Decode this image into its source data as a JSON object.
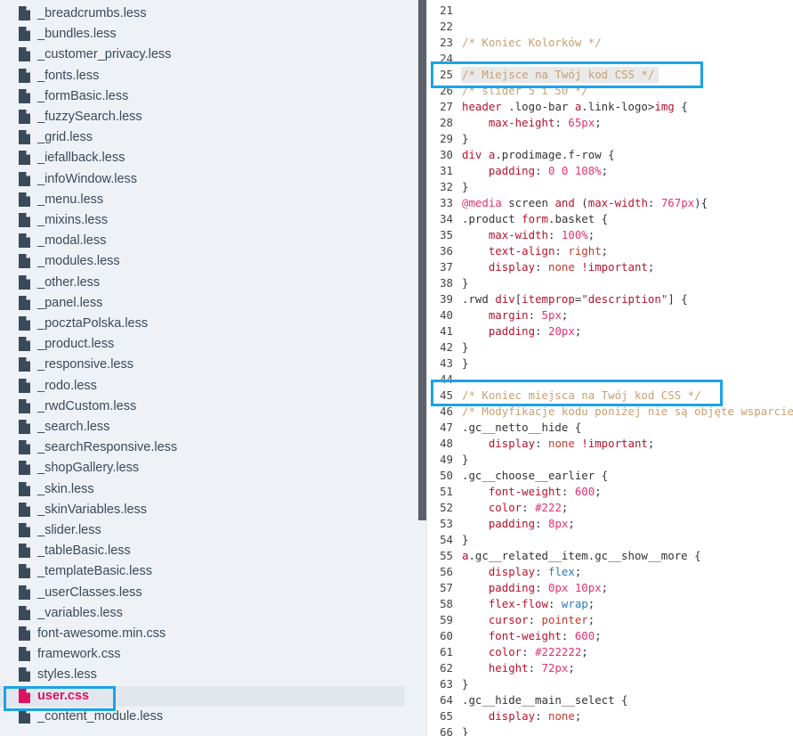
{
  "sidebar": {
    "files": [
      {
        "name": "_breadcrumbs.less"
      },
      {
        "name": "_bundles.less"
      },
      {
        "name": "_customer_privacy.less"
      },
      {
        "name": "_fonts.less"
      },
      {
        "name": "_formBasic.less"
      },
      {
        "name": "_fuzzySearch.less"
      },
      {
        "name": "_grid.less"
      },
      {
        "name": "_iefallback.less"
      },
      {
        "name": "_infoWindow.less"
      },
      {
        "name": "_menu.less"
      },
      {
        "name": "_mixins.less"
      },
      {
        "name": "_modal.less"
      },
      {
        "name": "_modules.less"
      },
      {
        "name": "_other.less"
      },
      {
        "name": "_panel.less"
      },
      {
        "name": "_pocztaPolska.less"
      },
      {
        "name": "_product.less"
      },
      {
        "name": "_responsive.less"
      },
      {
        "name": "_rodo.less"
      },
      {
        "name": "_rwdCustom.less"
      },
      {
        "name": "_search.less"
      },
      {
        "name": "_searchResponsive.less"
      },
      {
        "name": "_shopGallery.less"
      },
      {
        "name": "_skin.less"
      },
      {
        "name": "_skinVariables.less"
      },
      {
        "name": "_slider.less"
      },
      {
        "name": "_tableBasic.less"
      },
      {
        "name": "_templateBasic.less"
      },
      {
        "name": "_userClasses.less"
      },
      {
        "name": "_variables.less"
      },
      {
        "name": "font-awesome.min.css"
      },
      {
        "name": "framework.css"
      },
      {
        "name": "styles.less"
      },
      {
        "name": "user.css",
        "active": true
      },
      {
        "name": "_content_module.less"
      }
    ]
  },
  "editor": {
    "lines": [
      {
        "n": "21",
        "code": []
      },
      {
        "n": "22",
        "code": []
      },
      {
        "n": "23",
        "code": [
          {
            "t": "/* Koniec Kolorków */",
            "c": "com"
          }
        ]
      },
      {
        "n": "24",
        "code": []
      },
      {
        "n": "25",
        "code": [
          {
            "t": "/* Miejsce na Twój kod CSS */",
            "c": "com"
          }
        ],
        "selected": true
      },
      {
        "n": "26",
        "code": [
          {
            "t": "/* slider 5 i 50 */",
            "c": "com"
          }
        ]
      },
      {
        "n": "27",
        "code": [
          {
            "t": "header",
            "c": "kw"
          },
          {
            "t": " .logo-bar ",
            "c": ""
          },
          {
            "t": "a",
            "c": "kw"
          },
          {
            "t": ".link-logo>",
            "c": ""
          },
          {
            "t": "img",
            "c": "kw"
          },
          {
            "t": " {",
            "c": ""
          }
        ]
      },
      {
        "n": "28",
        "code": [
          {
            "t": "    max-height",
            "c": "kw"
          },
          {
            "t": ": ",
            "c": ""
          },
          {
            "t": "65px",
            "c": "num"
          },
          {
            "t": ";",
            "c": ""
          }
        ]
      },
      {
        "n": "29",
        "code": [
          {
            "t": "}",
            "c": ""
          }
        ]
      },
      {
        "n": "30",
        "code": [
          {
            "t": "div",
            "c": "kw"
          },
          {
            "t": " ",
            "c": ""
          },
          {
            "t": "a",
            "c": "kw"
          },
          {
            "t": ".prodimage.f-row {",
            "c": ""
          }
        ]
      },
      {
        "n": "31",
        "code": [
          {
            "t": "    padding",
            "c": "kw"
          },
          {
            "t": ": ",
            "c": ""
          },
          {
            "t": "0 0 108%",
            "c": "num"
          },
          {
            "t": ";",
            "c": ""
          }
        ]
      },
      {
        "n": "32",
        "code": [
          {
            "t": "}",
            "c": ""
          }
        ]
      },
      {
        "n": "33",
        "code": [
          {
            "t": "@media",
            "c": "at"
          },
          {
            "t": " screen ",
            "c": ""
          },
          {
            "t": "and",
            "c": "kw"
          },
          {
            "t": " (",
            "c": ""
          },
          {
            "t": "max-width",
            "c": "kw"
          },
          {
            "t": ": ",
            "c": ""
          },
          {
            "t": "767px",
            "c": "num"
          },
          {
            "t": "){",
            "c": ""
          }
        ]
      },
      {
        "n": "34",
        "code": [
          {
            "t": ".product ",
            "c": ""
          },
          {
            "t": "form",
            "c": "kw"
          },
          {
            "t": ".basket {",
            "c": ""
          }
        ]
      },
      {
        "n": "35",
        "code": [
          {
            "t": "    max-width",
            "c": "kw"
          },
          {
            "t": ": ",
            "c": ""
          },
          {
            "t": "100%",
            "c": "num"
          },
          {
            "t": ";",
            "c": ""
          }
        ]
      },
      {
        "n": "36",
        "code": [
          {
            "t": "    text-align",
            "c": "kw"
          },
          {
            "t": ": ",
            "c": ""
          },
          {
            "t": "right",
            "c": "val"
          },
          {
            "t": ";",
            "c": ""
          }
        ]
      },
      {
        "n": "37",
        "code": [
          {
            "t": "    display",
            "c": "kw"
          },
          {
            "t": ": ",
            "c": ""
          },
          {
            "t": "none",
            "c": "val"
          },
          {
            "t": " ",
            "c": ""
          },
          {
            "t": "!important",
            "c": "kw"
          },
          {
            "t": ";",
            "c": ""
          }
        ]
      },
      {
        "n": "38",
        "code": [
          {
            "t": "}",
            "c": ""
          }
        ]
      },
      {
        "n": "39",
        "code": [
          {
            "t": ".rwd ",
            "c": ""
          },
          {
            "t": "div",
            "c": "kw"
          },
          {
            "t": "[",
            "c": ""
          },
          {
            "t": "itemprop",
            "c": "kw"
          },
          {
            "t": "=",
            "c": ""
          },
          {
            "t": "\"description\"",
            "c": "str"
          },
          {
            "t": "] {",
            "c": ""
          }
        ]
      },
      {
        "n": "40",
        "code": [
          {
            "t": "    margin",
            "c": "kw"
          },
          {
            "t": ": ",
            "c": ""
          },
          {
            "t": "5px",
            "c": "num"
          },
          {
            "t": ";",
            "c": ""
          }
        ]
      },
      {
        "n": "41",
        "code": [
          {
            "t": "    padding",
            "c": "kw"
          },
          {
            "t": ": ",
            "c": ""
          },
          {
            "t": "20px",
            "c": "num"
          },
          {
            "t": ";",
            "c": ""
          }
        ]
      },
      {
        "n": "42",
        "code": [
          {
            "t": "}",
            "c": ""
          }
        ]
      },
      {
        "n": "43",
        "code": [
          {
            "t": "}",
            "c": ""
          }
        ]
      },
      {
        "n": "44",
        "code": []
      },
      {
        "n": "45",
        "code": [
          {
            "t": "/* Koniec miejsca na Twój kod CSS */",
            "c": "com"
          }
        ]
      },
      {
        "n": "46",
        "code": [
          {
            "t": "/* Modyfikacje kodu poniżej nie są objęte wsparciem",
            "c": "com"
          }
        ]
      },
      {
        "n": "47",
        "code": [
          {
            "t": ".gc__netto__hide {",
            "c": ""
          }
        ]
      },
      {
        "n": "48",
        "code": [
          {
            "t": "    display",
            "c": "kw"
          },
          {
            "t": ": ",
            "c": ""
          },
          {
            "t": "none",
            "c": "val"
          },
          {
            "t": " ",
            "c": ""
          },
          {
            "t": "!important",
            "c": "kw"
          },
          {
            "t": ";",
            "c": ""
          }
        ]
      },
      {
        "n": "49",
        "code": [
          {
            "t": "}",
            "c": ""
          }
        ]
      },
      {
        "n": "50",
        "code": [
          {
            "t": ".gc__choose__earlier {",
            "c": ""
          }
        ]
      },
      {
        "n": "51",
        "code": [
          {
            "t": "    font-weight",
            "c": "kw"
          },
          {
            "t": ": ",
            "c": ""
          },
          {
            "t": "600",
            "c": "num"
          },
          {
            "t": ";",
            "c": ""
          }
        ]
      },
      {
        "n": "52",
        "code": [
          {
            "t": "    color",
            "c": "kw"
          },
          {
            "t": ": ",
            "c": ""
          },
          {
            "t": "#222",
            "c": "num"
          },
          {
            "t": ";",
            "c": ""
          }
        ]
      },
      {
        "n": "53",
        "code": [
          {
            "t": "    padding",
            "c": "kw"
          },
          {
            "t": ": ",
            "c": ""
          },
          {
            "t": "8px",
            "c": "num"
          },
          {
            "t": ";",
            "c": ""
          }
        ]
      },
      {
        "n": "54",
        "code": [
          {
            "t": "}",
            "c": ""
          }
        ]
      },
      {
        "n": "55",
        "code": [
          {
            "t": "a",
            "c": "kw"
          },
          {
            "t": ".gc__related__item.gc__show__more {",
            "c": ""
          }
        ]
      },
      {
        "n": "56",
        "code": [
          {
            "t": "    display",
            "c": "kw"
          },
          {
            "t": ": ",
            "c": ""
          },
          {
            "t": "flex",
            "c": "blue"
          },
          {
            "t": ";",
            "c": ""
          }
        ]
      },
      {
        "n": "57",
        "code": [
          {
            "t": "    padding",
            "c": "kw"
          },
          {
            "t": ": ",
            "c": ""
          },
          {
            "t": "0px 10px",
            "c": "num"
          },
          {
            "t": ";",
            "c": ""
          }
        ]
      },
      {
        "n": "58",
        "code": [
          {
            "t": "    flex-flow",
            "c": "kw"
          },
          {
            "t": ": ",
            "c": ""
          },
          {
            "t": "wrap",
            "c": "blue"
          },
          {
            "t": ";",
            "c": ""
          }
        ]
      },
      {
        "n": "59",
        "code": [
          {
            "t": "    cursor",
            "c": "kw"
          },
          {
            "t": ": ",
            "c": ""
          },
          {
            "t": "pointer",
            "c": "val"
          },
          {
            "t": ";",
            "c": ""
          }
        ]
      },
      {
        "n": "60",
        "code": [
          {
            "t": "    font-weight",
            "c": "kw"
          },
          {
            "t": ": ",
            "c": ""
          },
          {
            "t": "600",
            "c": "num"
          },
          {
            "t": ";",
            "c": ""
          }
        ]
      },
      {
        "n": "61",
        "code": [
          {
            "t": "    color",
            "c": "kw"
          },
          {
            "t": ": ",
            "c": ""
          },
          {
            "t": "#222222",
            "c": "num"
          },
          {
            "t": ";",
            "c": ""
          }
        ]
      },
      {
        "n": "62",
        "code": [
          {
            "t": "    height",
            "c": "kw"
          },
          {
            "t": ": ",
            "c": ""
          },
          {
            "t": "72px",
            "c": "num"
          },
          {
            "t": ";",
            "c": ""
          }
        ]
      },
      {
        "n": "63",
        "code": [
          {
            "t": "}",
            "c": ""
          }
        ]
      },
      {
        "n": "64",
        "code": [
          {
            "t": ".gc__hide__main__select {",
            "c": ""
          }
        ]
      },
      {
        "n": "65",
        "code": [
          {
            "t": "    display",
            "c": "kw"
          },
          {
            "t": ": ",
            "c": ""
          },
          {
            "t": "none",
            "c": "val"
          },
          {
            "t": ";",
            "c": ""
          }
        ]
      },
      {
        "n": "66",
        "code": [
          {
            "t": "}",
            "c": ""
          }
        ]
      }
    ]
  },
  "colors": {
    "accent_highlight": "#1aa3e8",
    "active_file": "#e0115f",
    "file_icon": "#3b4a5a",
    "sidebar_bg": "#eef2f6"
  }
}
